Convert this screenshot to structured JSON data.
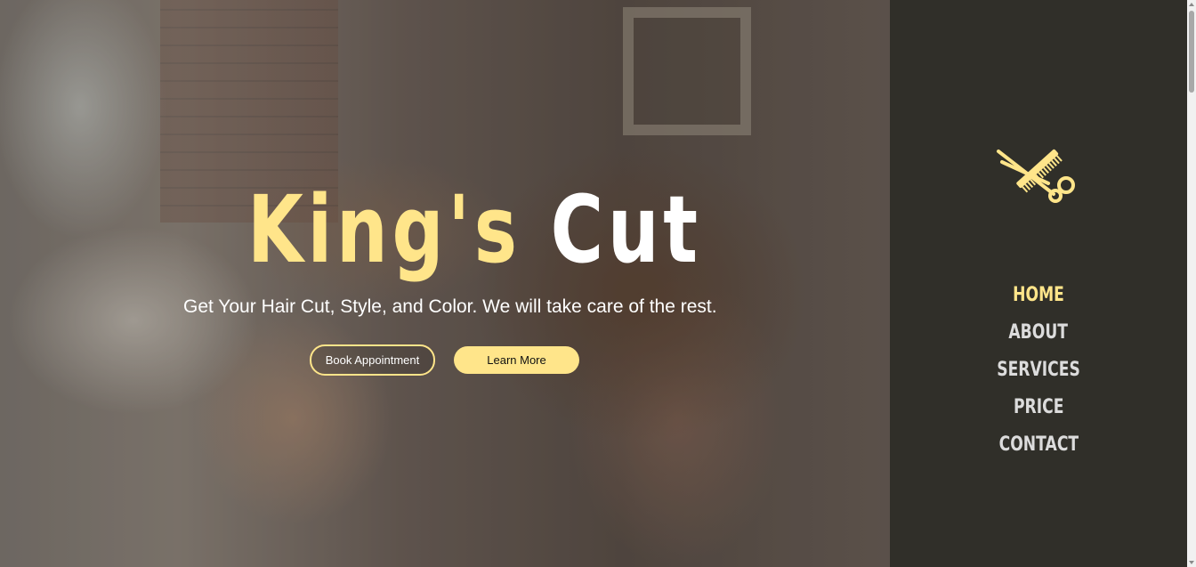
{
  "hero": {
    "title_part1": "King's",
    "title_part2": "Cut",
    "tagline": "Get Your Hair Cut, Style, and Color. We will take care of the rest.",
    "buttons": {
      "book": "Book Appointment",
      "learn": "Learn More"
    },
    "background_image": "barber-cutting-hair-photo"
  },
  "sidebar": {
    "logo_icon": "scissors-and-comb-icon",
    "nav": [
      {
        "label": "HOME",
        "active": true
      },
      {
        "label": "ABOUT",
        "active": false
      },
      {
        "label": "SERVICES",
        "active": false
      },
      {
        "label": "PRICE",
        "active": false
      },
      {
        "label": "CONTACT",
        "active": false
      }
    ]
  },
  "colors": {
    "accent": "#ffe58a",
    "sidebar_bg": "#302f29",
    "nav_text": "#dcdcdc",
    "title_white": "#ffffff"
  }
}
